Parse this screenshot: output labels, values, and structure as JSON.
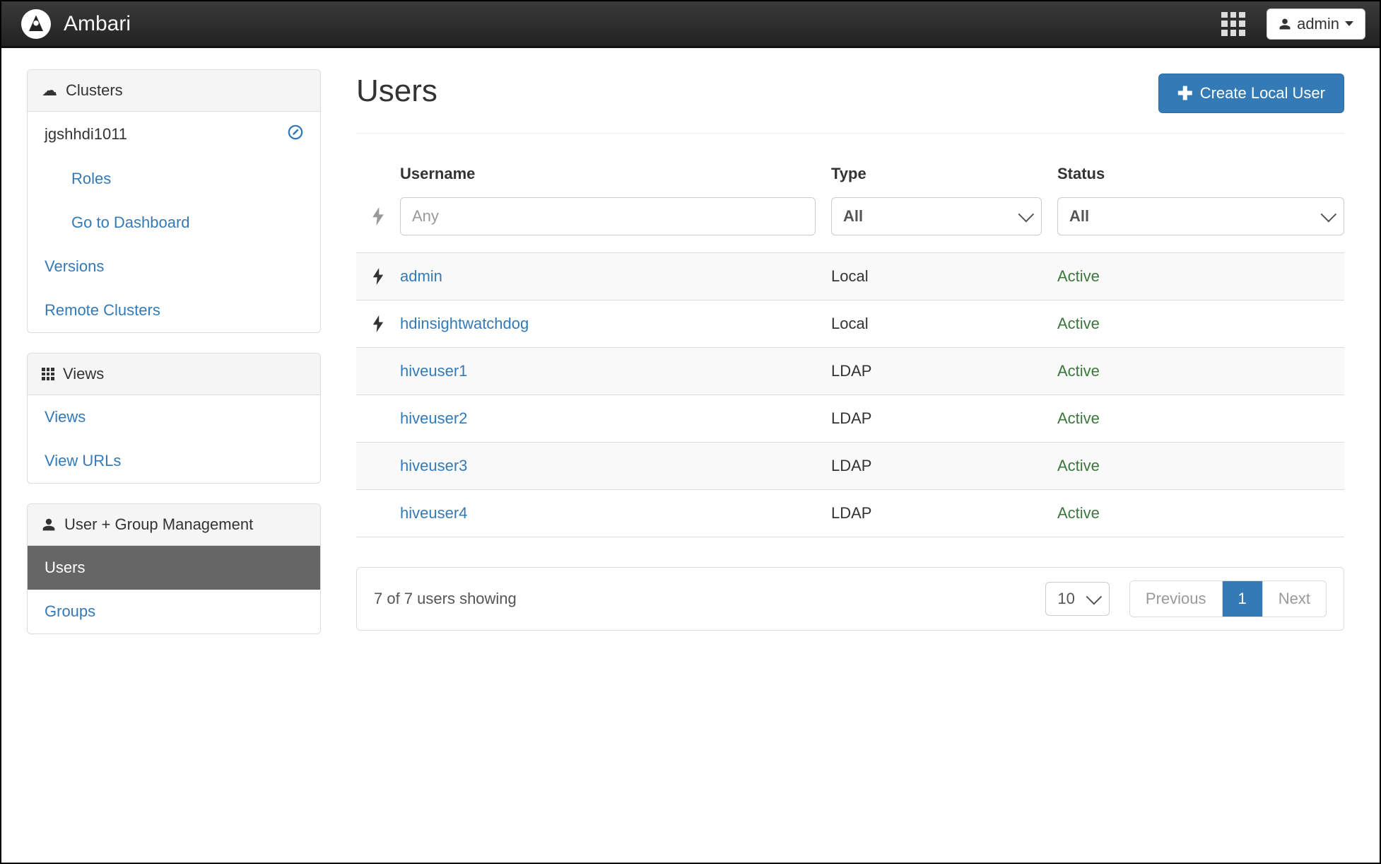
{
  "navbar": {
    "title": "Ambari",
    "user": "admin"
  },
  "sidebar": {
    "clusters": {
      "heading": "Clusters",
      "cluster_name": "jgshhdi1011",
      "roles": "Roles",
      "dashboard": "Go to Dashboard",
      "versions": "Versions",
      "remote": "Remote Clusters"
    },
    "views": {
      "heading": "Views",
      "views": "Views",
      "view_urls": "View URLs"
    },
    "usermgmt": {
      "heading": "User + Group Management",
      "users": "Users",
      "groups": "Groups"
    }
  },
  "main": {
    "title": "Users",
    "create_btn": "Create Local User",
    "columns": {
      "username": "Username",
      "type": "Type",
      "status": "Status"
    },
    "filters": {
      "username_placeholder": "Any",
      "type_value": "All",
      "status_value": "All"
    },
    "rows": [
      {
        "admin": true,
        "username": "admin",
        "type": "Local",
        "status": "Active"
      },
      {
        "admin": true,
        "username": "hdinsightwatchdog",
        "type": "Local",
        "status": "Active"
      },
      {
        "admin": false,
        "username": "hiveuser1",
        "type": "LDAP",
        "status": "Active"
      },
      {
        "admin": false,
        "username": "hiveuser2",
        "type": "LDAP",
        "status": "Active"
      },
      {
        "admin": false,
        "username": "hiveuser3",
        "type": "LDAP",
        "status": "Active"
      },
      {
        "admin": false,
        "username": "hiveuser4",
        "type": "LDAP",
        "status": "Active"
      }
    ],
    "footer": {
      "showing": "7 of 7 users showing",
      "page_size": "10",
      "previous": "Previous",
      "current": "1",
      "next": "Next"
    }
  }
}
